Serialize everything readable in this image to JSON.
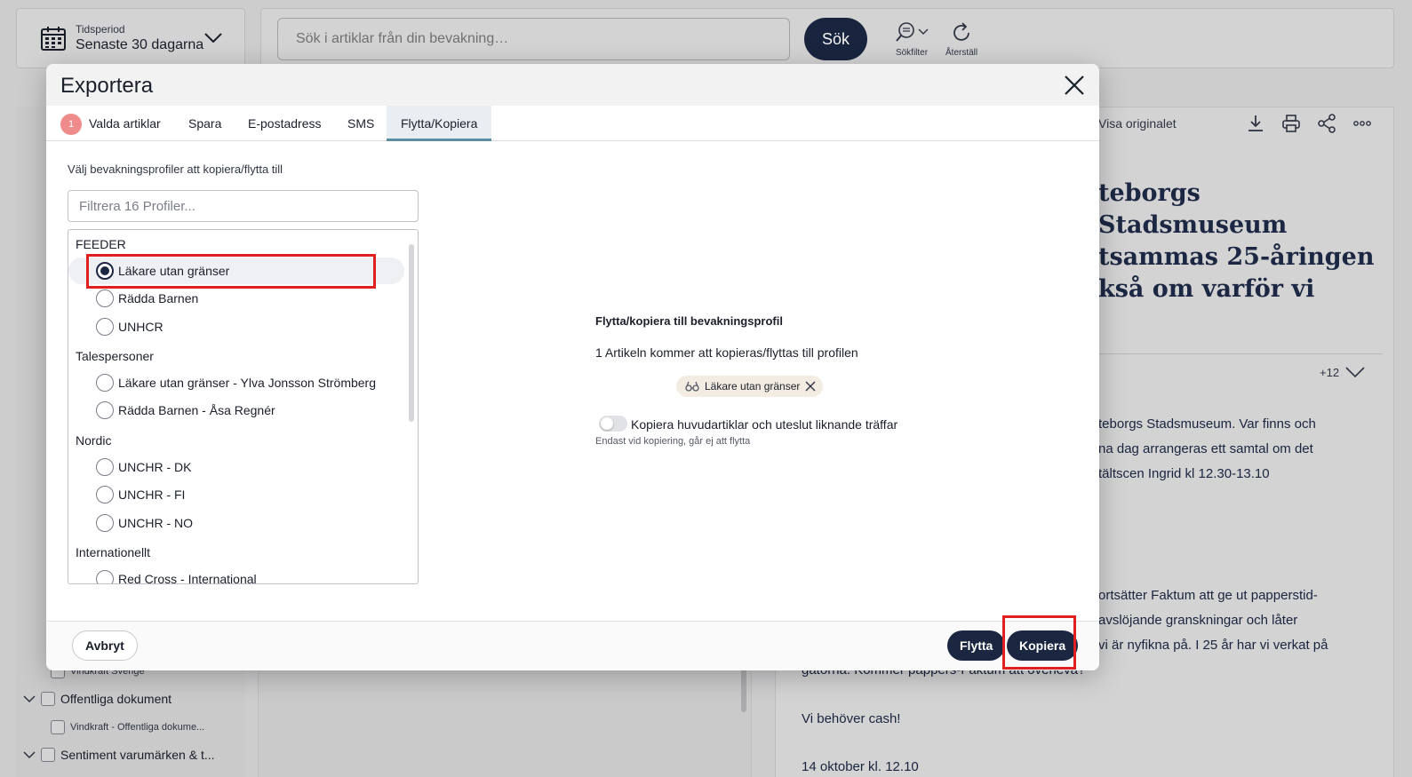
{
  "background": {
    "period": {
      "label": "Tidsperiod",
      "value": "Senaste 30 dagarna"
    },
    "search": {
      "placeholder": "Sök i artiklar från din bevakning…",
      "button": "Sök"
    },
    "tools": {
      "filter": "Sökfilter",
      "reset": "Återställ"
    },
    "tree": [
      {
        "label": "Vindkraft Sverige",
        "sub": true
      },
      {
        "label": "Offentliga dokument",
        "sub": false
      },
      {
        "label": "Vindkraft - Offentliga dokume...",
        "sub": true
      },
      {
        "label": "Sentiment varumärken & t...",
        "sub": false
      }
    ],
    "article": {
      "view_original": "Visa originalet",
      "headline_lines": [
        "teborgs Stadsmuseum",
        "tsammas 25-åringen",
        "kså om varför vi"
      ],
      "more_count": "+12",
      "para1": [
        "teborgs Stadsmuseum. Var finns och",
        "na dag arrangeras ett samtal om det",
        "tältscen Ingrid kl 12.30-13.10"
      ],
      "para2": [
        "ortsätter Faktum att ge ut papperstid-",
        "avslöjande granskningar och låter",
        "vi är nyfikna på. I 25 år har vi verkat på",
        "gatorna. Kommer pappers-Faktum att överleva?"
      ],
      "para3": "Vi behöver cash!",
      "para4": "14 oktober kl. 12.10"
    }
  },
  "modal": {
    "title": "Exportera",
    "tabs": {
      "badge": "1",
      "selected_articles": "Valda artiklar",
      "save": "Spara",
      "email": "E-postadress",
      "sms": "SMS",
      "move_copy": "Flytta/Kopiera"
    },
    "choose_label": "Välj bevakningsprofiler att kopiera/flytta till",
    "filter_placeholder": "Filtrera 16 Profiler...",
    "groups": {
      "feeder": "FEEDER",
      "spokespersons": "Talespersoner",
      "nordic": "Nordic",
      "international": "Internationellt"
    },
    "profiles": {
      "p1": "Läkare utan gränser",
      "p2": "Rädda Barnen",
      "p3": "UNHCR",
      "p4": "Läkare utan gränser - Ylva Jonsson Strömberg",
      "p5": "Rädda Barnen - Åsa Regnér",
      "p6": "UNCHR - DK",
      "p7": "UNCHR - FI",
      "p8": "UNCHR - NO",
      "p9": "Red Cross - International"
    },
    "selected_profile": "Läkare utan gränser",
    "right": {
      "title": "Flytta/kopiera till bevakningsprofil",
      "description": "1 Artikeln kommer att kopieras/flyttas till profilen",
      "chip": "Läkare utan gränser",
      "toggle_label": "Kopiera huvudartiklar och uteslut liknande träffar",
      "toggle_hint": "Endast vid kopiering, går ej att flytta"
    },
    "footer": {
      "cancel": "Avbryt",
      "move": "Flytta",
      "copy": "Kopiera"
    }
  }
}
